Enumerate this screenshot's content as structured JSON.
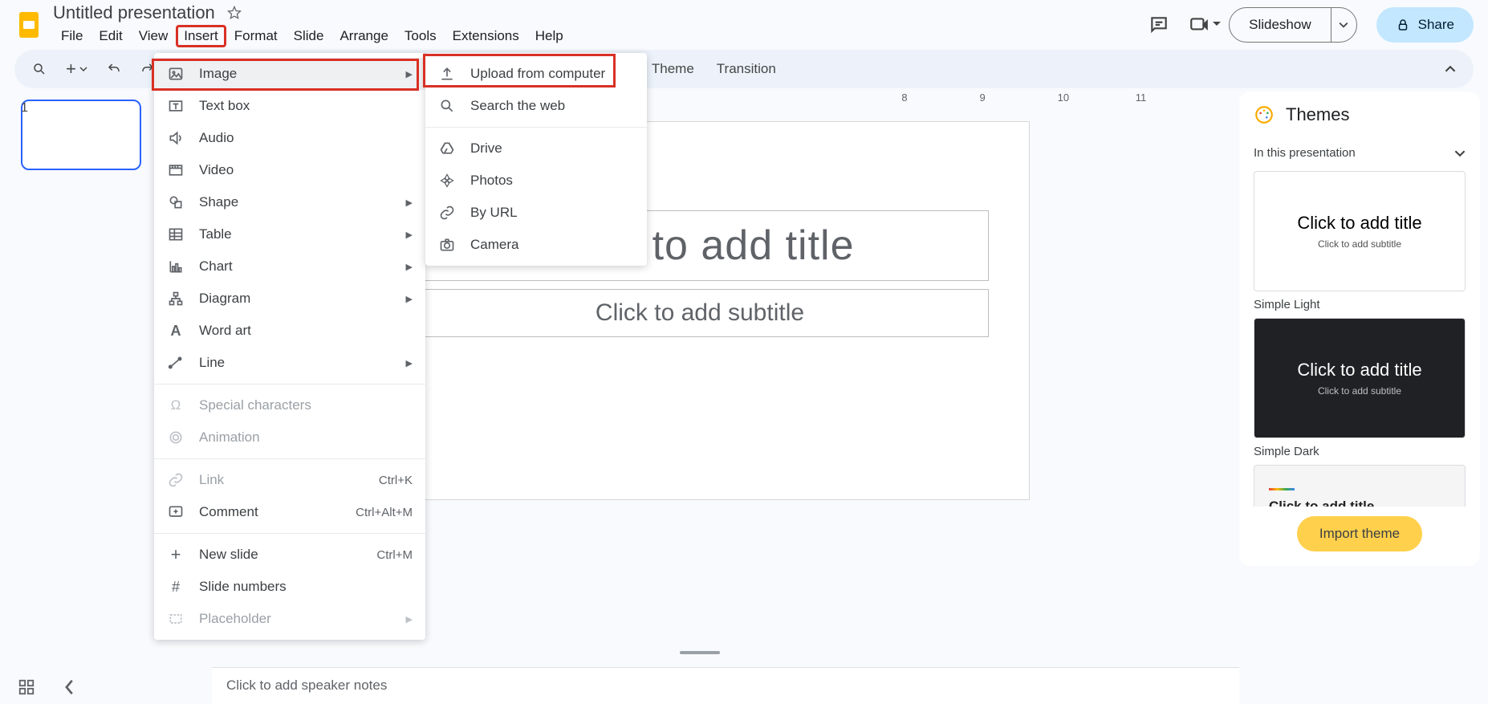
{
  "header": {
    "doc_title": "Untitled presentation",
    "menubar": [
      "File",
      "Edit",
      "View",
      "Insert",
      "Format",
      "Slide",
      "Arrange",
      "Tools",
      "Extensions",
      "Help"
    ],
    "slideshow_label": "Slideshow",
    "share_label": "Share"
  },
  "toolbar": {
    "theme_label": "Theme",
    "transition_label": "Transition"
  },
  "filmstrip": {
    "slide_number": "1"
  },
  "canvas": {
    "title_placeholder": "Click to add title",
    "subtitle_placeholder": "Click to add subtitle",
    "notes_placeholder": "Click to add speaker notes",
    "ruler": [
      "8",
      "9",
      "10",
      "11"
    ]
  },
  "insert_menu": {
    "items": [
      {
        "label": "Image",
        "icon": "image",
        "arrow": true,
        "hover": true
      },
      {
        "label": "Text box",
        "icon": "textbox"
      },
      {
        "label": "Audio",
        "icon": "audio"
      },
      {
        "label": "Video",
        "icon": "video"
      },
      {
        "label": "Shape",
        "icon": "shape",
        "arrow": true
      },
      {
        "label": "Table",
        "icon": "table",
        "arrow": true
      },
      {
        "label": "Chart",
        "icon": "chart",
        "arrow": true
      },
      {
        "label": "Diagram",
        "icon": "diagram",
        "arrow": true
      },
      {
        "label": "Word art",
        "icon": "wordart"
      },
      {
        "label": "Line",
        "icon": "line",
        "arrow": true
      }
    ],
    "special_chars": "Special characters",
    "animation": "Animation",
    "link": {
      "label": "Link",
      "shortcut": "Ctrl+K"
    },
    "comment": {
      "label": "Comment",
      "shortcut": "Ctrl+Alt+M"
    },
    "new_slide": {
      "label": "New slide",
      "shortcut": "Ctrl+M"
    },
    "slide_numbers": "Slide numbers",
    "placeholder": "Placeholder"
  },
  "image_submenu": {
    "items": [
      {
        "label": "Upload from computer",
        "icon": "upload"
      },
      {
        "label": "Search the web",
        "icon": "search"
      },
      {
        "label": "Drive",
        "icon": "drive",
        "sep_before": true
      },
      {
        "label": "Photos",
        "icon": "photos"
      },
      {
        "label": "By URL",
        "icon": "url"
      },
      {
        "label": "Camera",
        "icon": "camera"
      }
    ]
  },
  "themes": {
    "title": "Themes",
    "subtitle": "In this presentation",
    "import_label": "Import theme",
    "preview_title": "Click to add title",
    "preview_sub": "Click to add subtitle",
    "names": [
      "Simple Light",
      "Simple Dark"
    ]
  }
}
